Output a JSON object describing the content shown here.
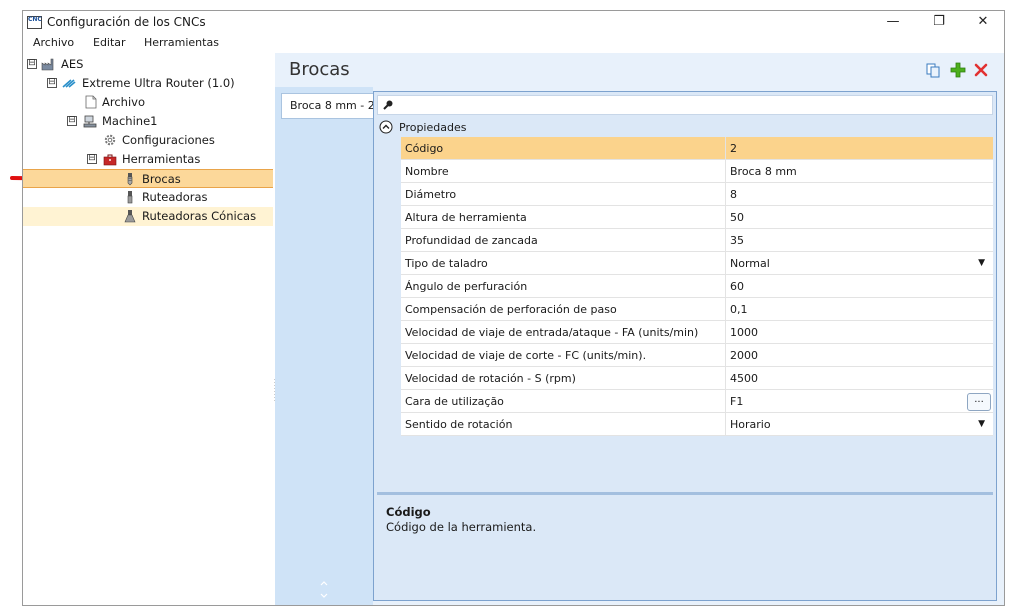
{
  "window": {
    "app_icon_text": "CNC",
    "title": "Configuración de los CNCs",
    "controls": {
      "minimize": "—",
      "maximize": "❐",
      "close": "✕"
    }
  },
  "menu": {
    "items": [
      "Archivo",
      "Editar",
      "Herramientas"
    ]
  },
  "tree": {
    "items": [
      {
        "label": "AES",
        "expander": "⊟",
        "icon": "factory-icon"
      },
      {
        "label": "Extreme Ultra Router (1.0)",
        "expander": "⊟",
        "icon": "router-logo-icon"
      },
      {
        "label": "Archivo",
        "icon": "file-icon"
      },
      {
        "label": "Machine1",
        "expander": "⊟",
        "icon": "machine-icon"
      },
      {
        "label": "Configuraciones",
        "icon": "gear-icon"
      },
      {
        "label": "Herramientas",
        "expander": "⊟",
        "icon": "toolbox-icon"
      },
      {
        "label": "Brocas",
        "icon": "drill-bit-icon",
        "selected": true
      },
      {
        "label": "Ruteadoras",
        "icon": "router-bit-icon"
      },
      {
        "label": "Ruteadoras Cónicas",
        "icon": "conical-bit-icon"
      }
    ]
  },
  "right": {
    "title": "Brocas",
    "tab": "Broca 8 mm - 2",
    "group_label": "Propiedades",
    "properties": [
      {
        "name": "Código",
        "value": "2"
      },
      {
        "name": "Nombre",
        "value": "Broca 8 mm"
      },
      {
        "name": "Diámetro",
        "value": "8"
      },
      {
        "name": "Altura de herramienta",
        "value": "50"
      },
      {
        "name": "Profundidad de zancada",
        "value": "35"
      },
      {
        "name": "Tipo de taladro",
        "value": "Normal"
      },
      {
        "name": "Ángulo de perfuración",
        "value": "60"
      },
      {
        "name": "Compensación de perforación de paso",
        "value": "0,1"
      },
      {
        "name": "Velocidad de viaje de entrada/ataque - FA (units/min)",
        "value": "1000"
      },
      {
        "name": "Velocidad de viaje de corte - FC (units/min).",
        "value": "2000"
      },
      {
        "name": "Velocidad de rotación - S (rpm)",
        "value": "4500"
      },
      {
        "name": "Cara de utilização",
        "value": "F1"
      },
      {
        "name": "Sentido de rotación",
        "value": "Horario"
      }
    ],
    "ellipsis_label": "...",
    "description": {
      "title": "Código",
      "text": "Código de la herramienta."
    }
  },
  "colors": {
    "selection": "#fbd38c",
    "accent_blue": "#7da2ce",
    "arrow_red": "#e01010",
    "add_green": "#4caf1c",
    "delete_red": "#e23131"
  }
}
